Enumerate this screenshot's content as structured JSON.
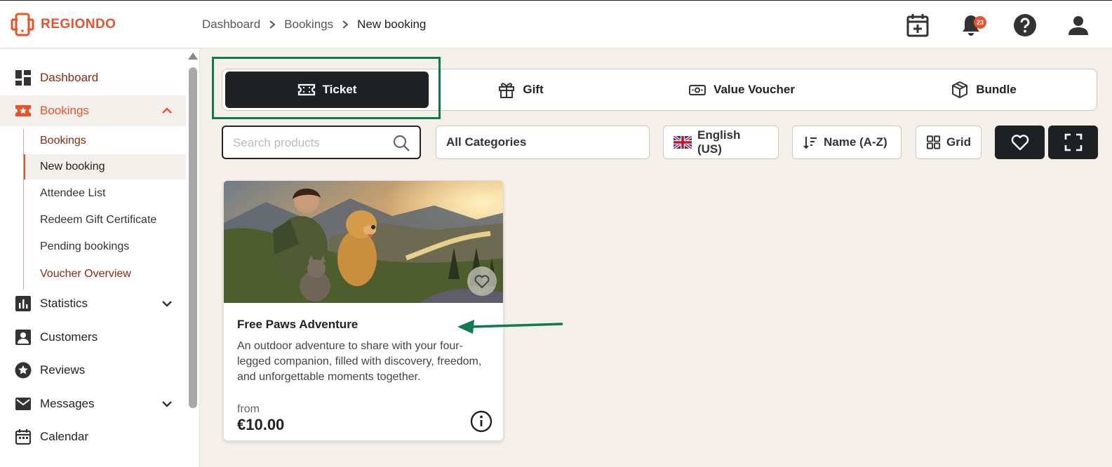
{
  "brand": {
    "name": "REGIONDO",
    "accent": "#e8532b"
  },
  "breadcrumb": [
    "Dashboard",
    "Bookings",
    "New booking"
  ],
  "header": {
    "icons": [
      "calendar-plus-icon",
      "bell-icon",
      "help-icon",
      "user-icon"
    ],
    "notification_count": "23"
  },
  "sidebar": {
    "items": [
      {
        "label": "Dashboard",
        "icon": "dashboard-icon"
      },
      {
        "label": "Bookings",
        "icon": "star-ticket-icon",
        "expanded": true
      },
      {
        "label": "Statistics",
        "icon": "bar-chart-icon"
      },
      {
        "label": "Customers",
        "icon": "contact-icon"
      },
      {
        "label": "Reviews",
        "icon": "star-badge-icon"
      },
      {
        "label": "Messages",
        "icon": "mail-icon"
      },
      {
        "label": "Calendar",
        "icon": "calendar-icon"
      }
    ],
    "sub_items": [
      "Bookings",
      "New booking",
      "Attendee List",
      "Redeem Gift Certificate",
      "Pending bookings",
      "Voucher Overview"
    ]
  },
  "type_tabs": [
    {
      "label": "Ticket",
      "icon": "ticket-icon",
      "active": true
    },
    {
      "label": "Gift",
      "icon": "gift-icon"
    },
    {
      "label": "Value Voucher",
      "icon": "voucher-icon"
    },
    {
      "label": "Bundle",
      "icon": "box-icon"
    }
  ],
  "filters": {
    "search_placeholder": "Search products",
    "category": "All Categories",
    "language": "English (US)",
    "sort": "Name (A-Z)",
    "view": "Grid"
  },
  "product": {
    "title": "Free Paws Adventure",
    "description": "An outdoor adventure to share with your four-legged companion, filled with discovery, freedom, and unforgettable moments together.",
    "from_label": "from",
    "price": "€10.00"
  },
  "colors": {
    "dark": "#1d2123",
    "annotation": "#0f7a4f",
    "background": "#f4efe9"
  }
}
